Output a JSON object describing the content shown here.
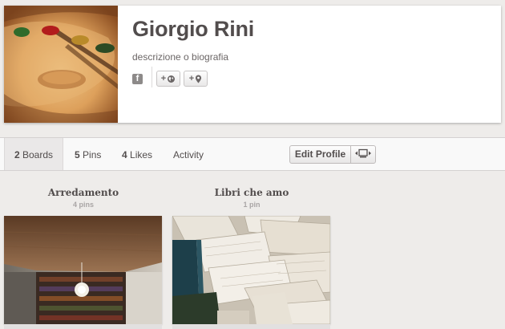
{
  "profile": {
    "name": "Giorgio Rini",
    "description": "descrizione o biografia",
    "facebook_icon": "f",
    "buttons": [
      {
        "label": "+",
        "icon": "globe-icon"
      },
      {
        "label": "+",
        "icon": "location-pin-icon"
      }
    ]
  },
  "nav": {
    "tabs": [
      {
        "count": "2",
        "label": "Boards",
        "active": true
      },
      {
        "count": "5",
        "label": "Pins",
        "active": false
      },
      {
        "count": "4",
        "label": "Likes",
        "active": false
      },
      {
        "count": "",
        "label": "Activity",
        "active": false
      }
    ],
    "edit_label": "Edit Profile",
    "layout_icon": "layout-toggle-icon"
  },
  "boards": [
    {
      "title": "Arredamento",
      "count": "4 pins"
    },
    {
      "title": "Libri che amo",
      "count": "1 pin"
    }
  ]
}
